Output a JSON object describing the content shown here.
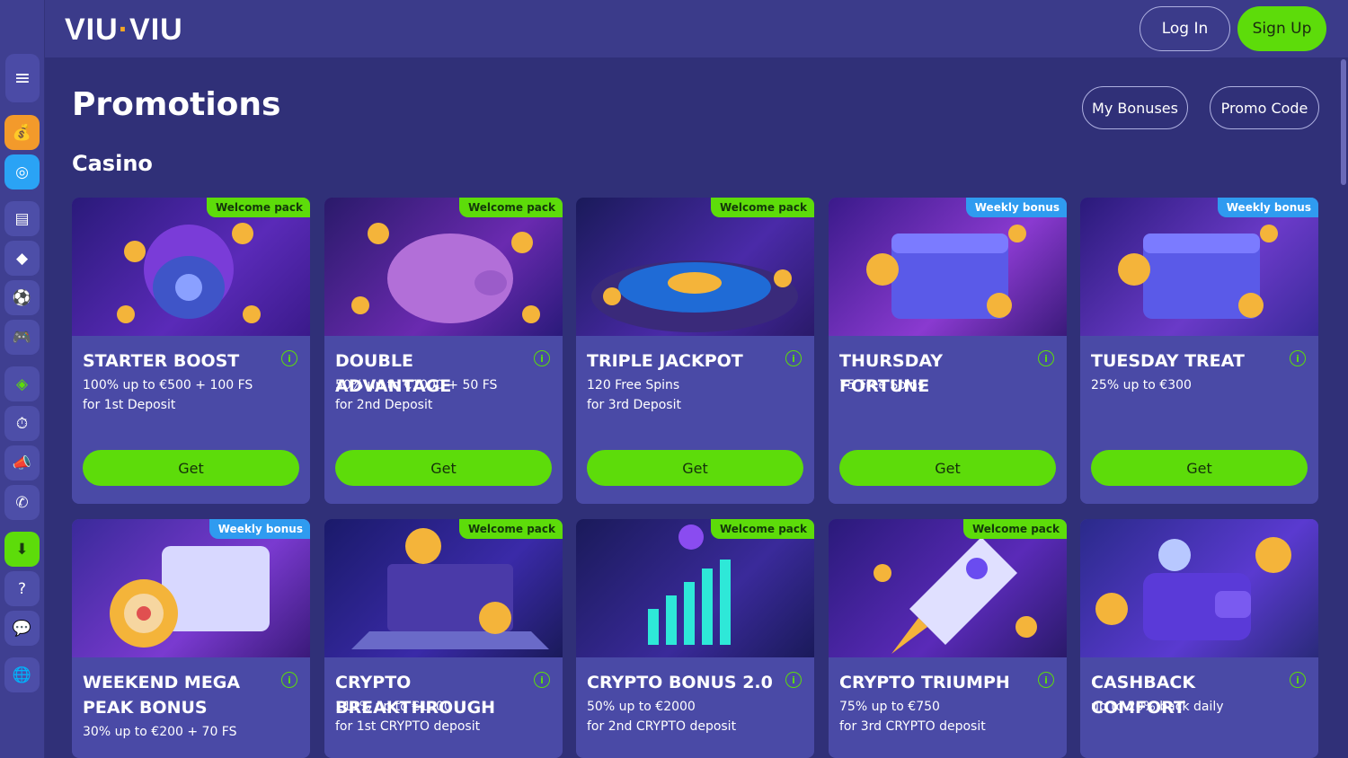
{
  "header": {
    "logo": "VIU VIU",
    "login_label": "Log In",
    "signup_label": "Sign Up"
  },
  "page": {
    "title": "Promotions",
    "my_bonuses_label": "My Bonuses",
    "promo_code_label": "Promo Code",
    "section_title": "Casino"
  },
  "sidebar": {
    "icons": [
      "menu-icon",
      "bag-icon",
      "target-icon",
      "ticket-icon",
      "sports-icon",
      "ball-icon",
      "gamepad-icon",
      "tag-icon",
      "stopwatch-icon",
      "megaphone-icon",
      "whatsapp-icon",
      "download-icon",
      "help-icon",
      "chat-icon",
      "globe-icon"
    ]
  },
  "cards": [
    {
      "title": "STARTER BOOST",
      "badge": "Welcome pack",
      "badge_type": "welcome",
      "line1": "100% up to €500 + 100 FS",
      "line2": "for 1st Deposit",
      "button": "Get",
      "art": "money-bag"
    },
    {
      "title": "DOUBLE ADVANTAGE",
      "badge": "Welcome pack",
      "badge_type": "welcome",
      "line1": "50% up to €1000 + 50 FS",
      "line2": "for 2nd Deposit",
      "button": "Get",
      "art": "piggy-bank"
    },
    {
      "title": "TRIPLE JACKPOT",
      "badge": "Welcome pack",
      "badge_type": "welcome",
      "line1": "120 Free Spins",
      "line2": "for 3rd Deposit",
      "button": "Get",
      "art": "roulette"
    },
    {
      "title": "THURSDAY FORTUNE",
      "badge": "Weekly bonus",
      "badge_type": "weekly",
      "line1": "75 Free Spins",
      "line2": "",
      "button": "Get",
      "art": "calendar"
    },
    {
      "title": "TUESDAY TREAT",
      "badge": "Weekly bonus",
      "badge_type": "weekly",
      "line1": "25% up to €300",
      "line2": "",
      "button": "Get",
      "art": "calendar"
    },
    {
      "title": "WEEKEND MEGA PEAK BONUS",
      "badge": "Weekly bonus",
      "badge_type": "weekly",
      "line1": "30% up to €200 + 70 FS",
      "line2": "",
      "button": "",
      "art": "target-calendar"
    },
    {
      "title": "CRYPTO BREAKTHROUGH",
      "badge": "Welcome pack",
      "badge_type": "welcome",
      "line1": "111% up to €1000",
      "line2": "for 1st CRYPTO deposit",
      "button": "",
      "art": "laptop"
    },
    {
      "title": "CRYPTO BONUS 2.0",
      "badge": "Welcome pack",
      "badge_type": "welcome",
      "line1": "50% up to €2000",
      "line2": "for 2nd CRYPTO deposit",
      "button": "",
      "art": "chart"
    },
    {
      "title": "CRYPTO TRIUMPH",
      "badge": "Welcome pack",
      "badge_type": "welcome",
      "line1": "75% up to €750",
      "line2": "for 3rd CRYPTO deposit",
      "button": "",
      "art": "rocket"
    },
    {
      "title": "CASHBACK COMFORT",
      "badge": "",
      "badge_type": "",
      "line1": "up to 20% back daily",
      "line2": "",
      "button": "",
      "art": "wallet"
    }
  ]
}
